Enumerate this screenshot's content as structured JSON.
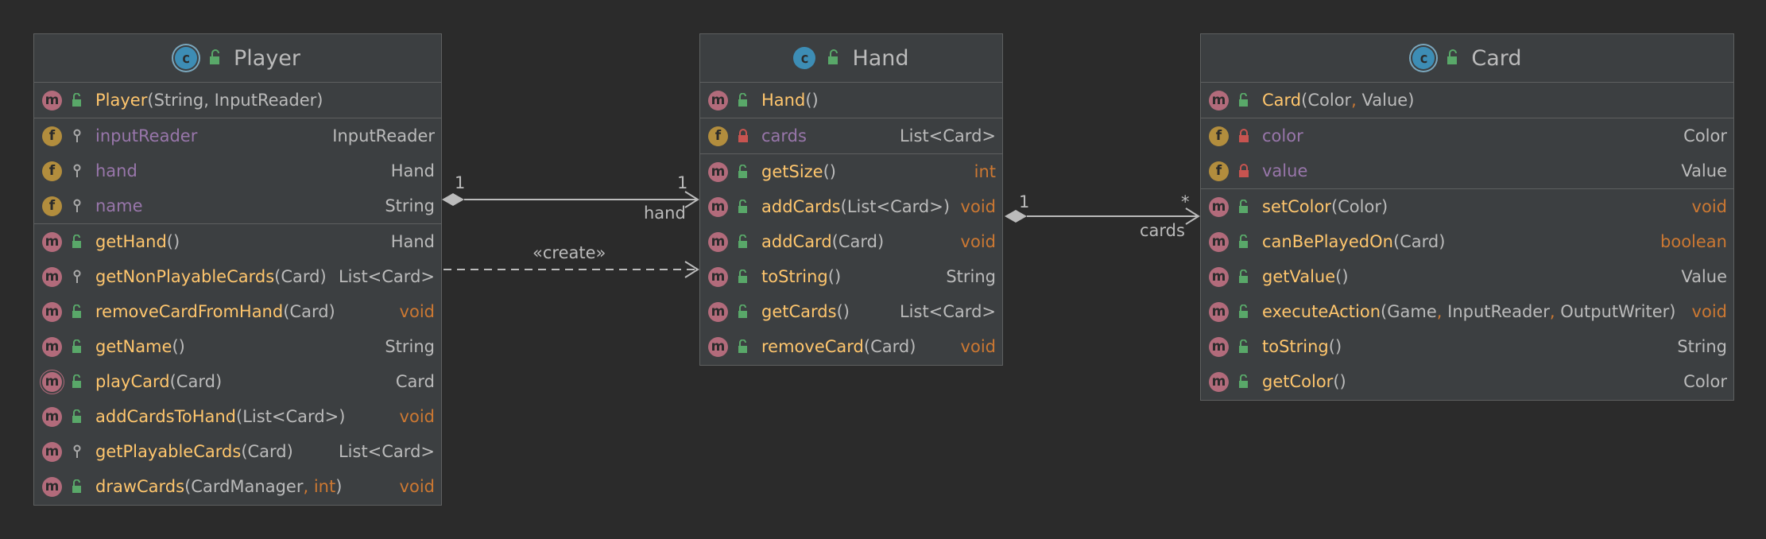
{
  "classes": {
    "player": {
      "name": "Player",
      "constructor": {
        "name": "Player",
        "params": "String, InputReader"
      },
      "fields": [
        {
          "name": "inputReader",
          "type": "InputReader"
        },
        {
          "name": "hand",
          "type": "Hand"
        },
        {
          "name": "name",
          "type": "String"
        }
      ],
      "methods": [
        {
          "name": "getHand",
          "params": "",
          "ret": "Hand"
        },
        {
          "name": "getNonPlayableCards",
          "params": "Card",
          "ret": "List<Card>"
        },
        {
          "name": "removeCardFromHand",
          "params": "Card",
          "ret": "void"
        },
        {
          "name": "getName",
          "params": "",
          "ret": "String"
        },
        {
          "name": "playCard",
          "params": "Card",
          "ret": "Card"
        },
        {
          "name": "addCardsToHand",
          "params": "List<Card>",
          "ret": "void"
        },
        {
          "name": "getPlayableCards",
          "params": "Card",
          "ret": "List<Card>"
        },
        {
          "name": "drawCards",
          "params_a": "CardManager",
          "params_sep": ",",
          "params_b": "int",
          "ret": "void"
        }
      ]
    },
    "hand": {
      "name": "Hand",
      "constructor": {
        "name": "Hand",
        "params": ""
      },
      "fields": [
        {
          "name": "cards",
          "type": "List<Card>"
        }
      ],
      "methods": [
        {
          "name": "getSize",
          "params": "",
          "ret": "int"
        },
        {
          "name": "addCards",
          "params": "List<Card>",
          "ret": "void"
        },
        {
          "name": "addCard",
          "params": "Card",
          "ret": "void"
        },
        {
          "name": "toString",
          "params": "",
          "ret": "String"
        },
        {
          "name": "getCards",
          "params": "",
          "ret": "List<Card>"
        },
        {
          "name": "removeCard",
          "params": "Card",
          "ret": "void"
        }
      ]
    },
    "card": {
      "name": "Card",
      "constructor": {
        "name": "Card",
        "params_a": "Color",
        "params_sep": ",",
        "params_b": "Value"
      },
      "fields": [
        {
          "name": "color",
          "type": "Color"
        },
        {
          "name": "value",
          "type": "Value"
        }
      ],
      "methods": [
        {
          "name": "setColor",
          "params": "Color",
          "ret": "void"
        },
        {
          "name": "canBePlayedOn",
          "params": "Card",
          "ret": "boolean"
        },
        {
          "name": "getValue",
          "params": "",
          "ret": "Value"
        },
        {
          "name": "executeAction",
          "params_a": "Game",
          "params_sep1": ",",
          "params_b": "InputReader",
          "params_sep2": ",",
          "params_c": "OutputWriter",
          "ret": "void"
        },
        {
          "name": "toString",
          "params": "",
          "ret": "String"
        },
        {
          "name": "getColor",
          "params": "",
          "ret": "Color"
        }
      ]
    }
  },
  "icons": {
    "class_letter": "c",
    "method_letter": "m",
    "field_letter": "f"
  },
  "relations": {
    "player_hand": {
      "source_mult": "1",
      "target_mult": "1",
      "role": "hand"
    },
    "create": {
      "label": "«create»"
    },
    "hand_card": {
      "source_mult": "1",
      "target_mult": "*",
      "role": "cards"
    }
  },
  "colors": {
    "background": "#2b2b2b",
    "box": "#3c3f41",
    "border": "#5e6060",
    "method_name": "#ffc66d",
    "field_name": "#9876aa",
    "keyword": "#cc7832",
    "text": "#bbbbbb",
    "class_icon": "#3d8db5",
    "method_icon": "#b26b7b",
    "field_icon": "#b28d3d",
    "public_lock": "#59a869",
    "private_lock": "#c75450"
  }
}
